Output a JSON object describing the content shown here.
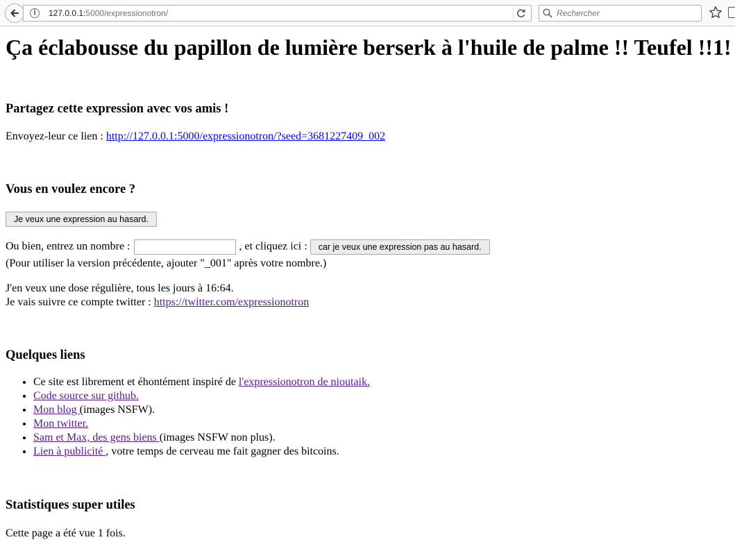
{
  "browser": {
    "url_host": "127.0.0.1:",
    "url_path": "5000/expressionotron/",
    "search_placeholder": "Rechercher"
  },
  "page": {
    "title": "Ça éclabousse du papillon de lumière berserk à l'huile de palme !! Teufel !!1!",
    "share": {
      "heading": "Partagez cette expression avec vos amis !",
      "prefix": "Envoyez-leur ce lien : ",
      "link": "http://127.0.0.1:5000/expressionotron/?seed=3681227409_002"
    },
    "more": {
      "heading": "Vous en voulez encore ?",
      "random_button": "Je veux une expression au hasard.",
      "number_prefix": "Ou bien, entrez un nombre : ",
      "number_value": "",
      "number_middle": " , et cliquez ici : ",
      "number_button": "car je veux une expression pas au hasard.",
      "version_note": "(Pour utiliser la version précédente, ajouter \"_001\" après votre nombre.)",
      "daily_text": "J'en veux une dose régulière, tous les jours à 16:64.",
      "twitter_prefix": "Je vais suivre ce compte twitter : ",
      "twitter_link": "https://twitter.com/expressionotron"
    },
    "links": {
      "heading": "Quelques liens",
      "items": [
        {
          "before": "Ce site est librement et éhontément inspiré de ",
          "link": "l'expressionotron de nioutaik.",
          "after": ""
        },
        {
          "before": "",
          "link": "Code source sur github.",
          "after": ""
        },
        {
          "before": "",
          "link": "Mon blog ",
          "after": "(images NSFW)."
        },
        {
          "before": "",
          "link": "Mon twitter.",
          "after": ""
        },
        {
          "before": "",
          "link": "Sam et Max, des gens biens ",
          "after": "(images NSFW non plus)."
        },
        {
          "before": "",
          "link": "Lien à publicité ",
          "after": ", votre temps de cerveau me fait gagner des bitcoins."
        }
      ]
    },
    "stats": {
      "heading": "Statistiques super utiles",
      "text": "Cette page a été vue 1 fois."
    }
  }
}
